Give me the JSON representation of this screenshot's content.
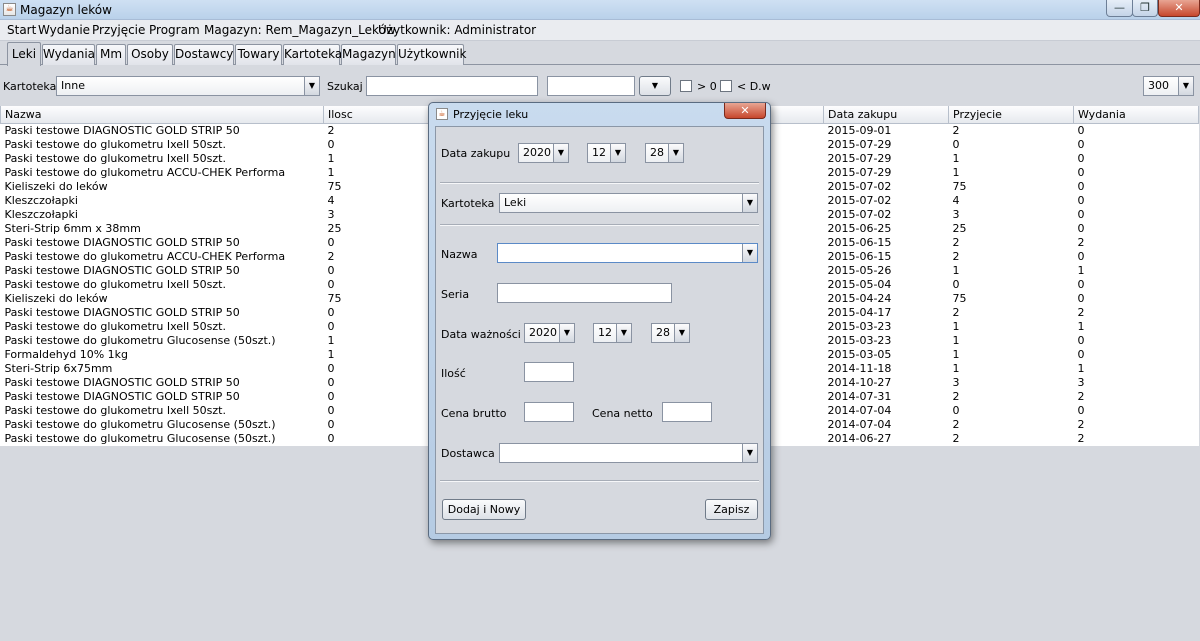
{
  "window": {
    "title": "Magazyn leków",
    "min_glyph": "—",
    "max_glyph": "❐",
    "close_glyph": "✕"
  },
  "menu": [
    "Start",
    "Wydanie",
    "Przyjęcie",
    "Program",
    "Magazyn: Rem_Magazyn_Leków",
    "Użytkownik: Administrator"
  ],
  "tabs": [
    "Leki",
    "Wydania",
    "Mm",
    "Osoby",
    "Dostawcy",
    "Towary",
    "Kartoteka",
    "Magazyn",
    "Użytkownik"
  ],
  "selected_tab": "Leki",
  "filter": {
    "kartoteka_label": "Kartoteka",
    "kartoteka_value": "Inne",
    "szukaj_label": "Szukaj",
    "search_value": "",
    "search2_value": "",
    "gt0_label": "> 0",
    "dw_label": "< D.w",
    "limit_value": "300",
    "arrow_glyph": "▼"
  },
  "table": {
    "headers": [
      "Nazwa",
      "Ilosc",
      "Data zakupu",
      "Przyjecie",
      "Wydania"
    ],
    "rows": [
      [
        "Paski testowe DIAGNOSTIC GOLD STRIP 50",
        "2",
        "2015-09-01",
        "2",
        "0"
      ],
      [
        "Paski testowe do glukometru Ixell 50szt.",
        "0",
        "2015-07-29",
        "0",
        "0"
      ],
      [
        "Paski testowe do glukometru Ixell 50szt.",
        "1",
        "2015-07-29",
        "1",
        "0"
      ],
      [
        "Paski testowe do glukometru ACCU-CHEK Performa",
        "1",
        "2015-07-29",
        "1",
        "0"
      ],
      [
        "Kieliszeki do leków",
        "75",
        "2015-07-02",
        "75",
        "0"
      ],
      [
        "Kleszczołapki",
        "4",
        "2015-07-02",
        "4",
        "0"
      ],
      [
        "Kleszczołapki",
        "3",
        "2015-07-02",
        "3",
        "0"
      ],
      [
        "Steri-Strip 6mm x 38mm",
        "25",
        "2015-06-25",
        "25",
        "0"
      ],
      [
        "Paski testowe DIAGNOSTIC GOLD STRIP 50",
        "0",
        "2015-06-15",
        "2",
        "2"
      ],
      [
        "Paski testowe do glukometru ACCU-CHEK Performa",
        "2",
        "2015-06-15",
        "2",
        "0"
      ],
      [
        "Paski testowe DIAGNOSTIC GOLD STRIP 50",
        "0",
        "2015-05-26",
        "1",
        "1"
      ],
      [
        "Paski testowe do glukometru Ixell 50szt.",
        "0",
        "2015-05-04",
        "0",
        "0"
      ],
      [
        "Kieliszeki do leków",
        "75",
        "2015-04-24",
        "75",
        "0"
      ],
      [
        "Paski testowe DIAGNOSTIC GOLD STRIP 50",
        "0",
        "2015-04-17",
        "2",
        "2"
      ],
      [
        "Paski testowe do glukometru Ixell 50szt.",
        "0",
        "2015-03-23",
        "1",
        "1"
      ],
      [
        "Paski testowe do glukometru Glucosense (50szt.)",
        "1",
        "2015-03-23",
        "1",
        "0"
      ],
      [
        "Formaldehyd 10%  1kg",
        "1",
        "2015-03-05",
        "1",
        "0"
      ],
      [
        "Steri-Strip 6x75mm",
        "0",
        "2014-11-18",
        "1",
        "1"
      ],
      [
        "Paski testowe DIAGNOSTIC GOLD STRIP 50",
        "0",
        "2014-10-27",
        "3",
        "3"
      ],
      [
        "Paski testowe DIAGNOSTIC GOLD STRIP 50",
        "0",
        "2014-07-31",
        "2",
        "2"
      ],
      [
        "Paski testowe do glukometru Ixell 50szt.",
        "0",
        "2014-07-04",
        "0",
        "0"
      ],
      [
        "Paski testowe do glukometru Glucosense (50szt.)",
        "0",
        "2014-07-04",
        "2",
        "2"
      ],
      [
        "Paski testowe do glukometru Glucosense (50szt.)",
        "0",
        "2014-06-27",
        "2",
        "2"
      ]
    ]
  },
  "dialog": {
    "title": "Przyjęcie leku",
    "close_glyph": "✕",
    "data_zakupu_label": "Data zakupu",
    "zakup_year": "2020",
    "zakup_month": "12",
    "zakup_day": "28",
    "kartoteka_label": "Kartoteka",
    "kartoteka_value": "Leki",
    "nazwa_label": "Nazwa",
    "nazwa_value": "",
    "seria_label": "Seria",
    "seria_value": "",
    "data_waznosci_label": "Data ważności",
    "waz_year": "2020",
    "waz_month": "12",
    "waz_day": "28",
    "ilosc_label": "Ilość",
    "ilosc_value": "",
    "cena_brutto_label": "Cena brutto",
    "cena_brutto_value": "",
    "cena_netto_label": "Cena netto",
    "cena_netto_value": "",
    "dostawca_label": "Dostawca",
    "dostawca_value": "",
    "dodaj_label": "Dodaj i Nowy",
    "zapisz_label": "Zapisz"
  }
}
